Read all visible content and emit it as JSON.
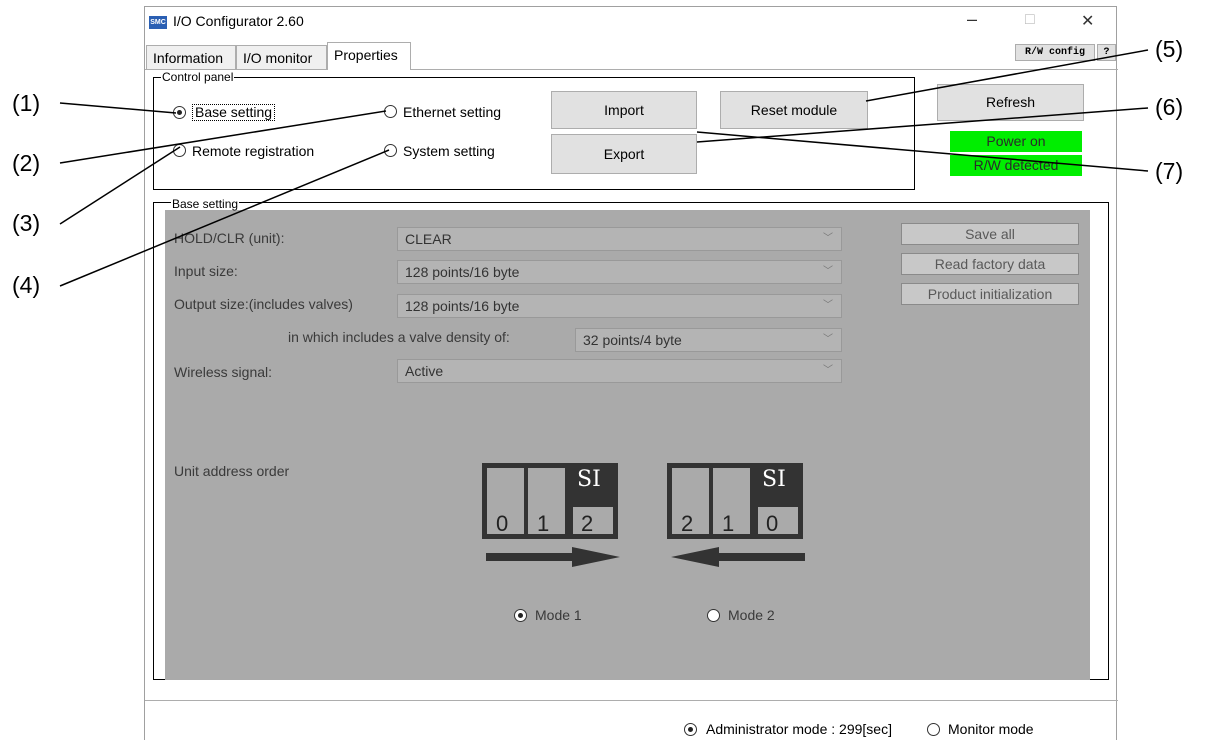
{
  "window": {
    "title": "I/O Configurator 2.60",
    "logo_text": "SMC",
    "controls": {
      "minimize": "–",
      "maximize": "□",
      "close": "✕"
    }
  },
  "tabs": [
    "Information",
    "I/O monitor",
    "Properties"
  ],
  "top_right_buttons": {
    "rw_config": "R/W config",
    "help": "?"
  },
  "control_panel": {
    "legend": "Control panel",
    "radios": {
      "base_setting": "Base setting",
      "ethernet_setting": "Ethernet setting",
      "remote_registration": "Remote registration",
      "system_setting": "System setting"
    },
    "buttons": {
      "import": "Import",
      "export": "Export",
      "reset_module": "Reset module"
    }
  },
  "refresh_label": "Refresh",
  "status": {
    "power_on": "Power on",
    "rw_detected": "R/W detected",
    "color": "#00ee00"
  },
  "base_setting": {
    "legend": "Base setting",
    "fields": {
      "hold_clr_label": "HOLD/CLR (unit):",
      "hold_clr_value": "CLEAR",
      "input_size_label": "Input size:",
      "input_size_value": "128 points/16 byte",
      "output_size_label": "Output size:(includes valves)",
      "output_size_value": "128 points/16 byte",
      "valve_density_label": "in which includes a valve density of:",
      "valve_density_value": "32 points/4 byte",
      "wireless_label": "Wireless signal:",
      "wireless_value": "Active"
    },
    "buttons": {
      "save_all": "Save all",
      "read_factory": "Read factory data",
      "product_init": "Product initialization"
    },
    "unit_address_order_label": "Unit address order",
    "mode1": {
      "si": "SI",
      "digits": [
        "0",
        "1",
        "2"
      ],
      "label": "Mode 1"
    },
    "mode2": {
      "si": "SI",
      "digits": [
        "2",
        "1",
        "0"
      ],
      "label": "Mode 2"
    }
  },
  "footer": {
    "admin_mode": "Administrator mode : 299[sec]",
    "monitor_mode": "Monitor mode"
  },
  "callouts": [
    "(1)",
    "(2)",
    "(3)",
    "(4)",
    "(5)",
    "(6)",
    "(7)"
  ]
}
